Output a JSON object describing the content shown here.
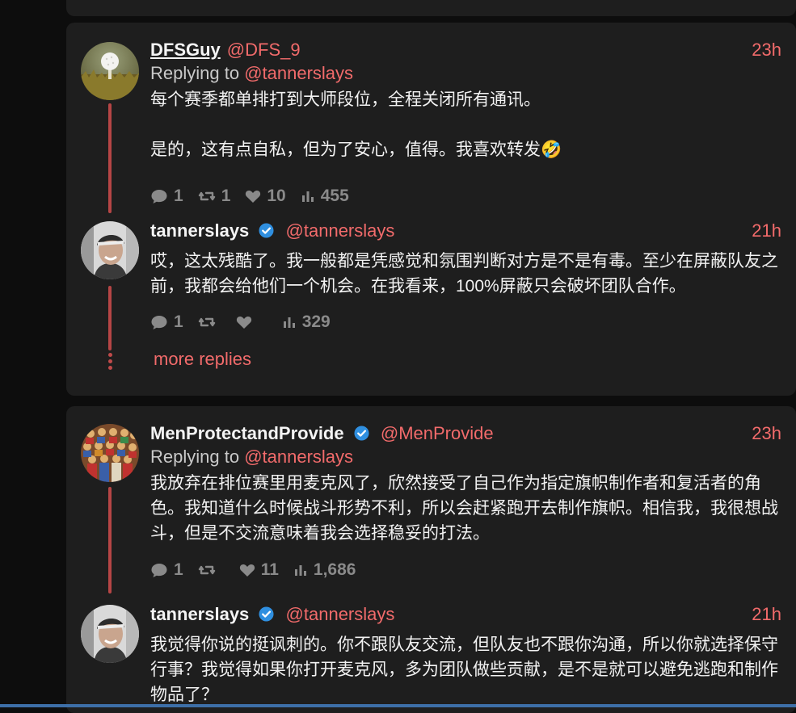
{
  "thread1": {
    "post1": {
      "name": "DFSGuy",
      "handle": "@DFS_9",
      "time": "23h",
      "replying_prefix": "Replying to",
      "replying_to": "@tannerslays",
      "body": "每个赛季都单排打到大师段位，全程关闭所有通讯。\n\n是的，这有点自私，但为了安心，值得。我喜欢转发🤣",
      "stats": {
        "comments": "1",
        "reposts": "1",
        "likes": "10",
        "views": "455"
      }
    },
    "post2": {
      "name": "tannerslays",
      "handle": "@tannerslays",
      "time": "21h",
      "body": "哎，这太残酷了。我一般都是凭感觉和氛围判断对方是不是有毒。至少在屏蔽队友之前，我都会给他们一个机会。在我看来，100%屏蔽只会破坏团队合作。",
      "stats": {
        "comments": "1",
        "reposts": "",
        "likes": "",
        "views": "329"
      }
    },
    "more_replies": "more replies"
  },
  "thread2": {
    "post1": {
      "name": "MenProtectandProvide",
      "handle": "@MenProvide",
      "time": "23h",
      "replying_prefix": "Replying to",
      "replying_to": "@tannerslays",
      "body": "我放弃在排位赛里用麦克风了，欣然接受了自己作为指定旗帜制作者和复活者的角色。我知道什么时候战斗形势不利，所以会赶紧跑开去制作旗帜。相信我，我很想战斗，但是不交流意味着我会选择稳妥的打法。",
      "stats": {
        "comments": "1",
        "reposts": "",
        "likes": "11",
        "views": "1,686"
      }
    },
    "post2": {
      "name": "tannerslays",
      "handle": "@tannerslays",
      "time": "21h",
      "body": "我觉得你说的挺讽刺的。你不跟队友交流，但队友也不跟你沟通，所以你就选择保守行事？我觉得如果你打开麦克风，多为团队做些贡献，是不是就可以避免逃跑和制作物品了？"
    }
  },
  "colors": {
    "accent": "#f26b6b",
    "thread_line": "#b64545",
    "card": "#1e1e1e",
    "verified": "#2f8fe0"
  }
}
